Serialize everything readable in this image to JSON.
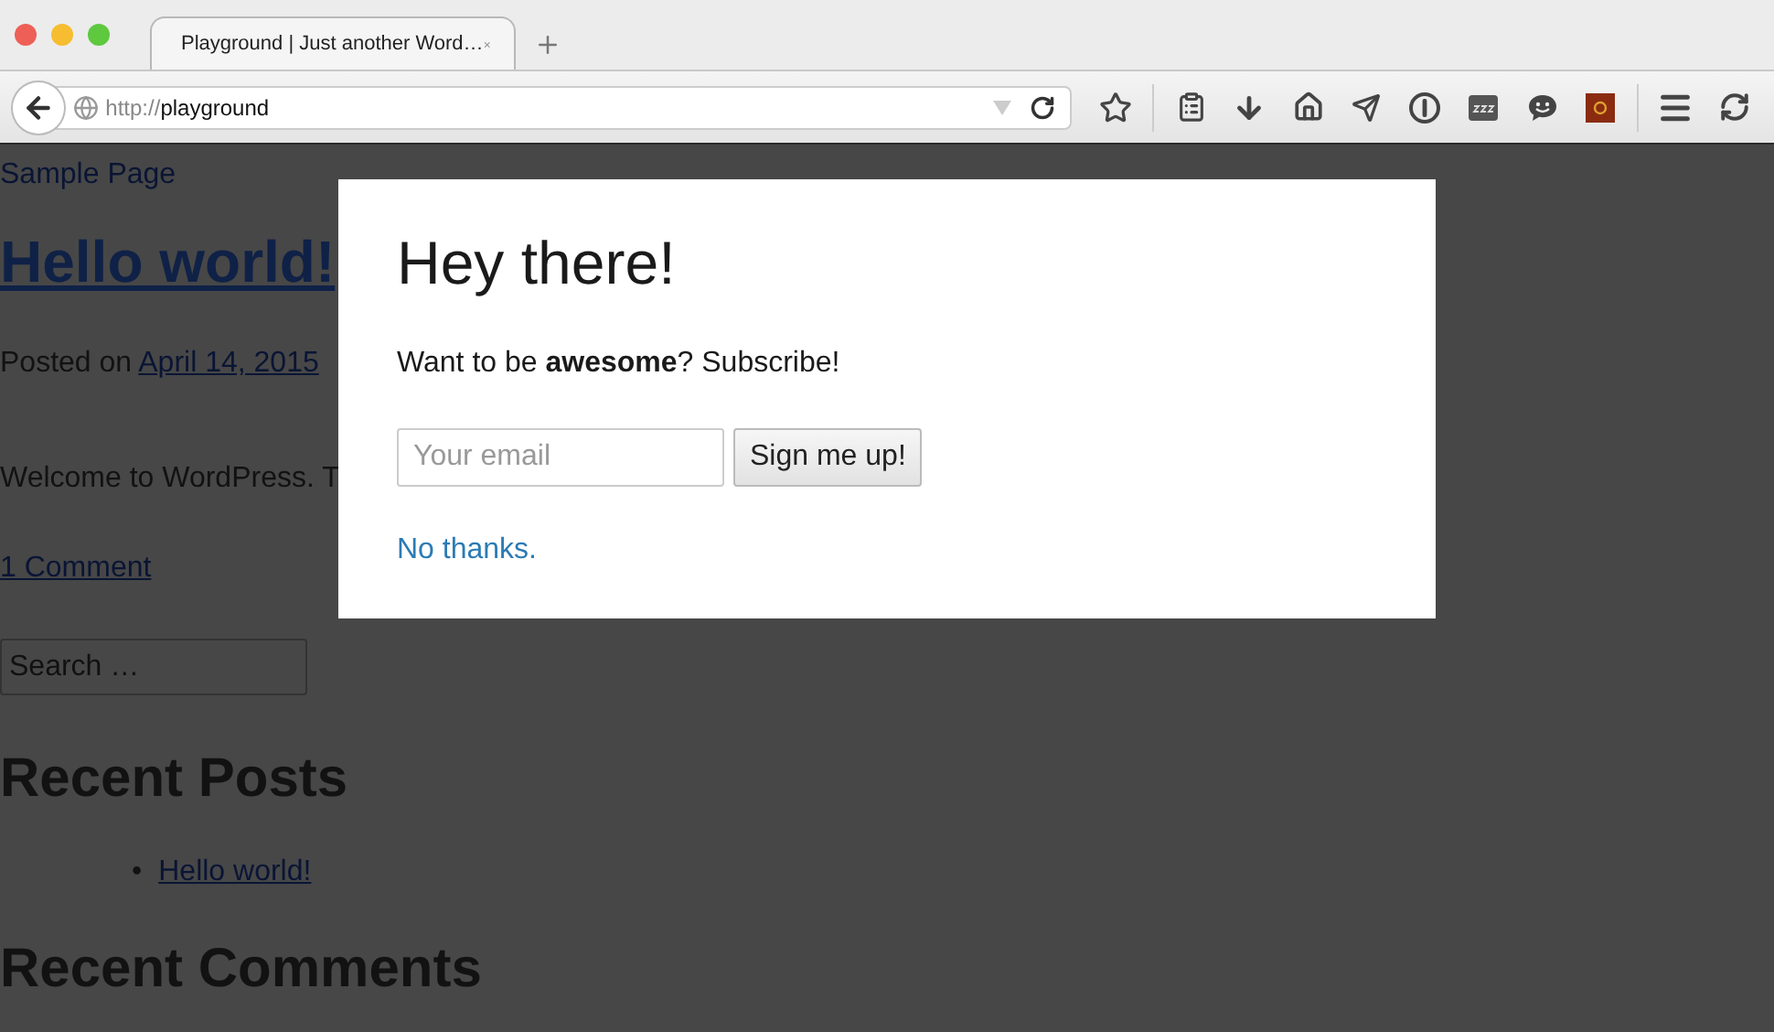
{
  "browser": {
    "tabs": [
      {
        "title": "Playground | Just another Word…",
        "selected": true
      }
    ],
    "address": {
      "scheme": "http://",
      "host": "playground"
    }
  },
  "page": {
    "nav_link": "Sample Page",
    "post_title": "Hello world!",
    "posted_on": "Posted on",
    "date": "April 14, 2015",
    "excerpt": "Welcome to WordPress. T",
    "comments_link": "1 Comment",
    "search": {
      "placeholder": "Search …"
    },
    "widgets": [
      {
        "heading": "Recent Posts",
        "bullet": "•",
        "links": [
          "Hello world!"
        ]
      },
      {
        "heading": "Recent Comments"
      }
    ]
  },
  "modal": {
    "title": "Hey there!",
    "message": "Want to be **awesome**? Subscribe!",
    "email": {
      "placeholder": "Your email"
    },
    "submit": "Sign me up!",
    "dismiss": "No thanks."
  }
}
